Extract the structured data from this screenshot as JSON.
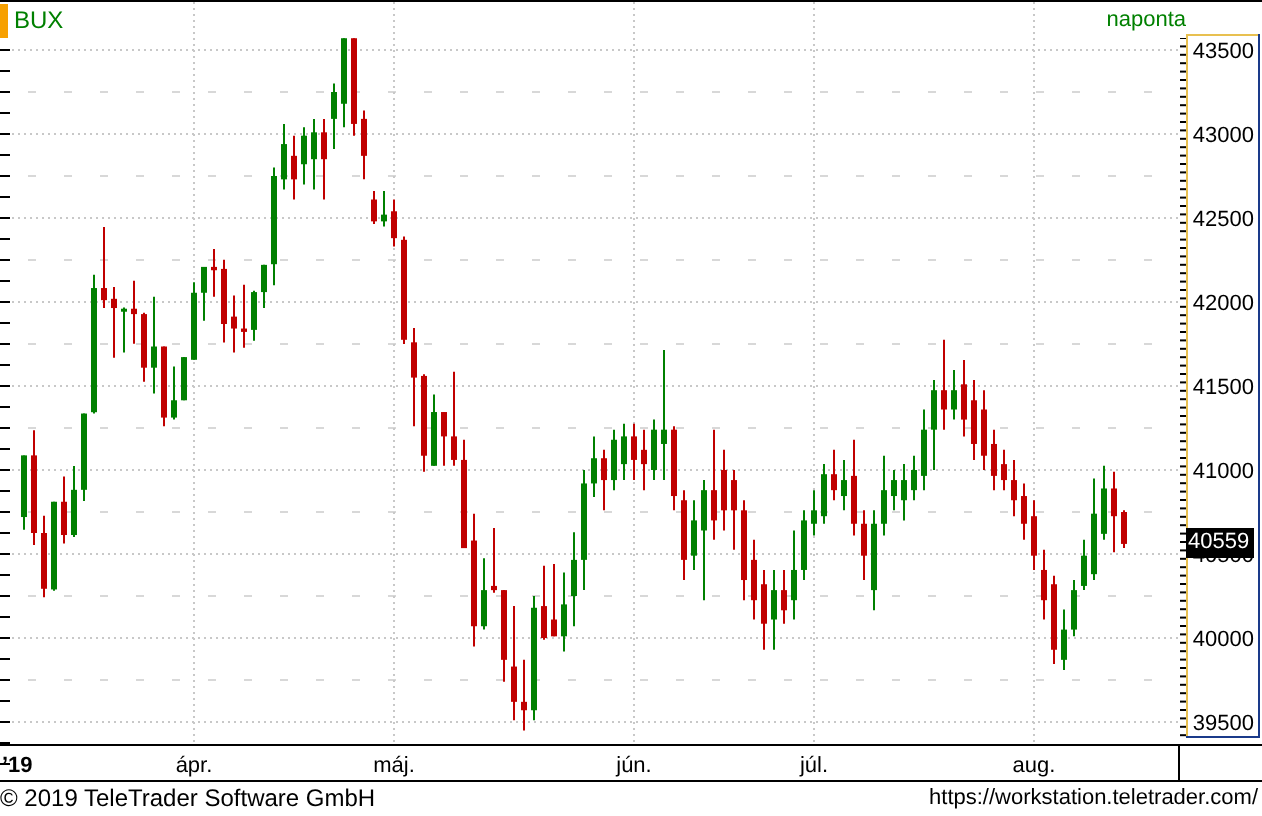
{
  "interval": "naponta",
  "last_price": "40559",
  "chart_data": {
    "type": "candlestick",
    "ylim": [
      39500,
      43500
    ],
    "grid": true,
    "yticks": [
      39500,
      40000,
      40500,
      41000,
      41500,
      42000,
      42500,
      43000,
      43500
    ],
    "categories": [
      null,
      null,
      null,
      null,
      null,
      null,
      null,
      null,
      null,
      null,
      null,
      null,
      null,
      null,
      null,
      null,
      null,
      "ápr.",
      null,
      null,
      null,
      null,
      null,
      null,
      null,
      null,
      null,
      null,
      null,
      null,
      null,
      null,
      null,
      null,
      null,
      null,
      null,
      "máj.",
      null,
      null,
      null,
      null,
      null,
      null,
      null,
      null,
      null,
      null,
      null,
      null,
      null,
      null,
      null,
      null,
      null,
      null,
      null,
      null,
      null,
      null,
      null,
      "jún.",
      null,
      null,
      null,
      null,
      null,
      null,
      null,
      null,
      null,
      null,
      null,
      null,
      null,
      null,
      null,
      null,
      null,
      "júl.",
      null,
      null,
      null,
      null,
      null,
      null,
      null,
      null,
      null,
      null,
      null,
      null,
      null,
      null,
      null,
      null,
      null,
      null,
      null,
      null,
      null,
      "aug.",
      null,
      null,
      null,
      null,
      null,
      null,
      null,
      null,
      null
    ],
    "annotations": [
      {
        "text": "’19"
      }
    ],
    "series": [
      {
        "name": "BUX",
        "ohlc": [
          [
            40720,
            41087,
            40645,
            41087
          ],
          [
            41087,
            41237,
            40554,
            40625
          ],
          [
            40625,
            40728,
            40242,
            40293
          ],
          [
            40289,
            40811,
            40281,
            40811
          ],
          [
            40811,
            40961,
            40562,
            40613
          ],
          [
            40613,
            41024,
            40601,
            40882
          ],
          [
            40882,
            41336,
            40815,
            41336
          ],
          [
            41344,
            42162,
            41336,
            42083
          ],
          [
            42083,
            42446,
            41964,
            42011
          ],
          [
            42019,
            42090,
            41668,
            41964
          ],
          [
            41952,
            41968,
            41699,
            41960
          ],
          [
            41960,
            42126,
            41751,
            41928
          ],
          [
            41928,
            41936,
            41526,
            41609
          ],
          [
            41609,
            42031,
            41455,
            41735
          ],
          [
            41735,
            41735,
            41261,
            41312
          ],
          [
            41312,
            41616,
            41300,
            41415
          ],
          [
            41415,
            41672,
            41415,
            41672
          ],
          [
            41656,
            42118,
            41656,
            42055
          ],
          [
            42055,
            42209,
            41889,
            42209
          ],
          [
            42209,
            42316,
            42031,
            42189
          ],
          [
            42197,
            42252,
            41759,
            41869
          ],
          [
            41913,
            42039,
            41699,
            41842
          ],
          [
            41842,
            42102,
            41727,
            41822
          ],
          [
            41834,
            42067,
            41770,
            42059
          ],
          [
            42059,
            42221,
            41964,
            42221
          ],
          [
            42225,
            42800,
            42100,
            42750
          ],
          [
            42730,
            43060,
            42670,
            42940
          ],
          [
            42870,
            42990,
            42610,
            42730
          ],
          [
            42820,
            43040,
            42700,
            42990
          ],
          [
            42850,
            43090,
            42670,
            43010
          ],
          [
            43010,
            43090,
            42610,
            42850
          ],
          [
            43090,
            43300,
            42910,
            43250
          ],
          [
            43180,
            43570,
            43040,
            43570
          ],
          [
            43570,
            43570,
            42990,
            43060
          ],
          [
            43090,
            43140,
            42730,
            42870
          ],
          [
            42610,
            42660,
            42465,
            42480
          ],
          [
            42480,
            42660,
            42450,
            42520
          ],
          [
            42540,
            42610,
            42330,
            42380
          ],
          [
            42370,
            42390,
            41750,
            41775
          ],
          [
            41760,
            41845,
            41260,
            41550
          ],
          [
            41560,
            41570,
            40990,
            41085
          ],
          [
            41025,
            41450,
            41025,
            41345
          ],
          [
            41345,
            41345,
            41025,
            41200
          ],
          [
            41200,
            41585,
            41025,
            41060
          ],
          [
            41060,
            41180,
            40535,
            40535
          ],
          [
            40580,
            40740,
            39950,
            40070
          ],
          [
            40070,
            40475,
            40050,
            40285
          ],
          [
            40310,
            40655,
            40270,
            40285
          ],
          [
            40285,
            40285,
            39740,
            39870
          ],
          [
            39830,
            40190,
            39510,
            39620
          ],
          [
            39620,
            39870,
            39450,
            39570
          ],
          [
            39570,
            40250,
            39510,
            40180
          ],
          [
            40190,
            40430,
            39990,
            40000
          ],
          [
            40110,
            40440,
            40010,
            40010
          ],
          [
            40010,
            40390,
            39920,
            40200
          ],
          [
            40250,
            40630,
            40070,
            40465
          ],
          [
            40465,
            41000,
            40285,
            40920
          ],
          [
            40920,
            41200,
            40840,
            41070
          ],
          [
            41070,
            41120,
            40760,
            40940
          ],
          [
            40940,
            41240,
            40880,
            41180
          ],
          [
            41035,
            41275,
            40940,
            41200
          ],
          [
            41200,
            41275,
            40940,
            41060
          ],
          [
            41120,
            41240,
            40880,
            41035
          ],
          [
            41000,
            41300,
            40940,
            41240
          ],
          [
            41155,
            41715,
            40940,
            41240
          ],
          [
            41240,
            41260,
            40760,
            40845
          ],
          [
            40820,
            40880,
            40345,
            40465
          ],
          [
            40490,
            40820,
            40405,
            40700
          ],
          [
            40640,
            40940,
            40225,
            40880
          ],
          [
            40880,
            41240,
            40585,
            40700
          ],
          [
            41000,
            41120,
            40640,
            40760
          ],
          [
            40940,
            41000,
            40525,
            40760
          ],
          [
            40760,
            40820,
            40225,
            40345
          ],
          [
            40465,
            40585,
            40110,
            40225
          ],
          [
            40320,
            40405,
            39930,
            40085
          ],
          [
            40110,
            40405,
            39930,
            40285
          ],
          [
            40285,
            40405,
            40085,
            40165
          ],
          [
            40225,
            40640,
            40110,
            40405
          ],
          [
            40405,
            40760,
            40345,
            40700
          ],
          [
            40680,
            40880,
            40610,
            40760
          ],
          [
            40725,
            41035,
            40680,
            40975
          ],
          [
            40975,
            41120,
            40820,
            40880
          ],
          [
            40845,
            41060,
            40760,
            40940
          ],
          [
            40965,
            41180,
            40610,
            40680
          ],
          [
            40680,
            40760,
            40345,
            40490
          ],
          [
            40285,
            40760,
            40165,
            40680
          ],
          [
            40680,
            41085,
            40610,
            40880
          ],
          [
            40845,
            41000,
            40760,
            40940
          ],
          [
            40820,
            41035,
            40700,
            40940
          ],
          [
            40880,
            41085,
            40820,
            41000
          ],
          [
            40965,
            41360,
            40880,
            41240
          ],
          [
            41240,
            41535,
            41000,
            41475
          ],
          [
            41475,
            41775,
            41240,
            41360
          ],
          [
            41360,
            41595,
            41300,
            41475
          ],
          [
            41510,
            41655,
            41200,
            41300
          ],
          [
            41415,
            41535,
            41060,
            41155
          ],
          [
            41360,
            41475,
            41000,
            41085
          ],
          [
            41155,
            41240,
            40880,
            40965
          ],
          [
            41035,
            41120,
            40880,
            40940
          ],
          [
            40940,
            41060,
            40725,
            40820
          ],
          [
            40845,
            40920,
            40585,
            40680
          ],
          [
            40725,
            40820,
            40405,
            40490
          ],
          [
            40405,
            40525,
            40110,
            40225
          ],
          [
            40320,
            40370,
            39845,
            39930
          ],
          [
            39870,
            40170,
            39810,
            40050
          ],
          [
            40050,
            40345,
            40010,
            40285
          ],
          [
            40310,
            40585,
            40285,
            40490
          ],
          [
            40380,
            40950,
            40345,
            40740
          ],
          [
            40620,
            41025,
            40585,
            40890
          ],
          [
            40890,
            40990,
            40510,
            40725
          ],
          [
            40750,
            40760,
            40535,
            40560
          ]
        ]
      }
    ]
  },
  "footer": {
    "copyright": "© 2019 TeleTrader Software GmbH",
    "url": "https://workstation.teletrader.com/"
  }
}
